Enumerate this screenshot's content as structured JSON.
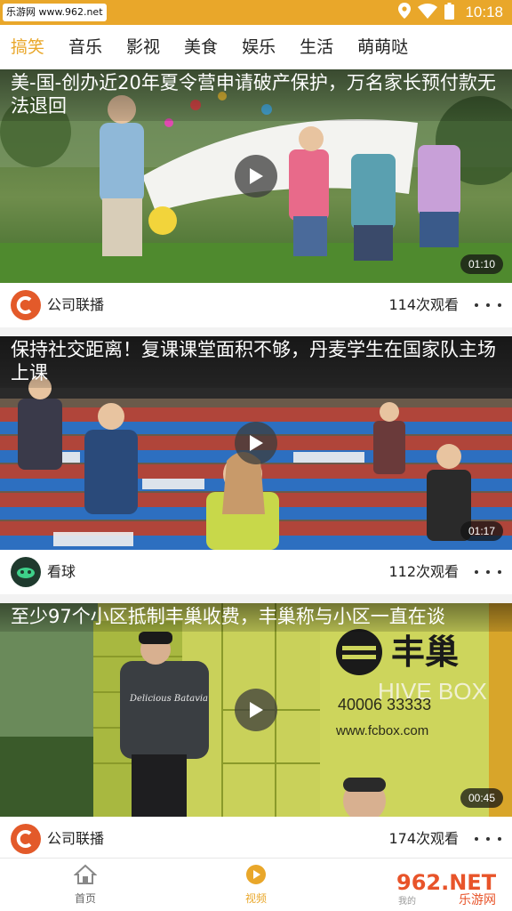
{
  "status_bar": {
    "watermark": "乐游网 www.962.net",
    "time": "10:18",
    "bg_color": "#e9a72a",
    "icons": [
      "location-icon",
      "wifi-icon",
      "battery-icon"
    ]
  },
  "tabs": [
    {
      "label": "搞笑",
      "active": true
    },
    {
      "label": "音乐",
      "active": false
    },
    {
      "label": "影视",
      "active": false
    },
    {
      "label": "美食",
      "active": false
    },
    {
      "label": "娱乐",
      "active": false
    },
    {
      "label": "生活",
      "active": false
    },
    {
      "label": "萌萌哒",
      "active": false
    }
  ],
  "videos": [
    {
      "title": "美-国-创办近20年夏令营申请破产保护，万名家长预付款无法退回",
      "duration": "01:10",
      "channel": "公司联播",
      "channel_icon": "c-logo-icon",
      "views": "114次观看"
    },
    {
      "title": "保持社交距离！复课课堂面积不够，丹麦学生在国家队主场上课",
      "duration": "01:17",
      "channel": "看球",
      "channel_icon": "ball-logo-icon",
      "views": "112次观看"
    },
    {
      "title": "至少97个小区抵制丰巢收费，丰巢称与小区一直在谈",
      "duration": "00:45",
      "channel": "公司联播",
      "channel_icon": "c-logo-icon",
      "views": "174次观看"
    }
  ],
  "scene_text": {
    "hivebox_logo": "丰巢",
    "hivebox_en": "HIVE BOX",
    "hivebox_phone": "40006 33333",
    "hivebox_web": "www.fcbox.com",
    "jacket_text": "Delicious Batavia"
  },
  "bottom_nav": [
    {
      "label": "首页",
      "icon": "home-icon",
      "active": false
    },
    {
      "label": "视频",
      "icon": "play-circle-icon",
      "active": true
    }
  ],
  "corner_watermark": {
    "brand": "962.NET",
    "sub": "乐游网",
    "small": "我的"
  },
  "colors": {
    "accent": "#e9a72a",
    "inactive": "#666666"
  }
}
